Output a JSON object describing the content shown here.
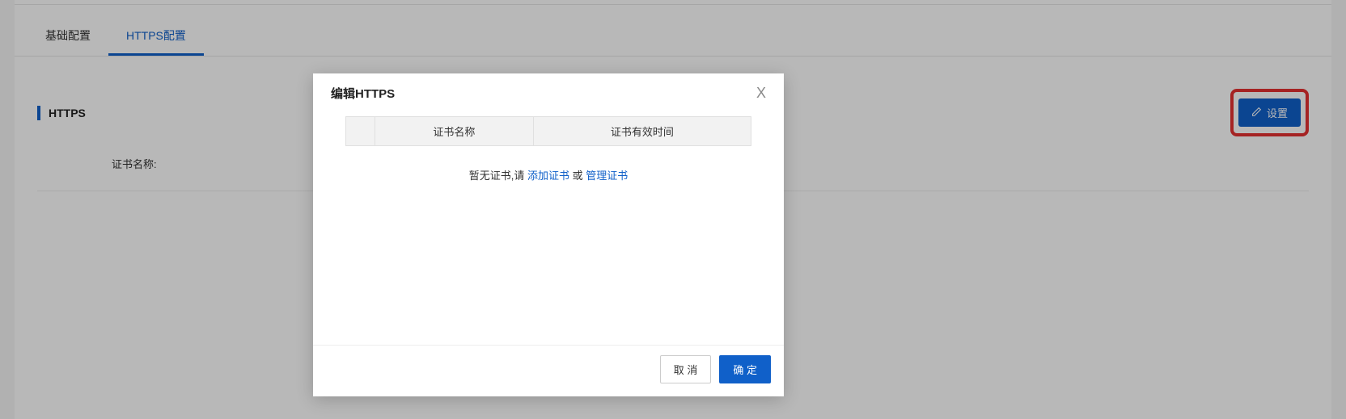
{
  "tabs": {
    "basic": "基础配置",
    "https": "HTTPS配置"
  },
  "section": {
    "title": "HTTPS",
    "settings_button": "设置"
  },
  "field": {
    "cert_name_label": "证书名称:"
  },
  "modal": {
    "title": "编辑HTTPS",
    "close": "X",
    "table": {
      "col_cert_name": "证书名称",
      "col_cert_valid": "证书有效时间"
    },
    "empty_prefix": "暂无证书,请 ",
    "add_link": "添加证书",
    "empty_mid": " 或 ",
    "manage_link": "管理证书",
    "cancel": "取 消",
    "ok": "确 定"
  }
}
